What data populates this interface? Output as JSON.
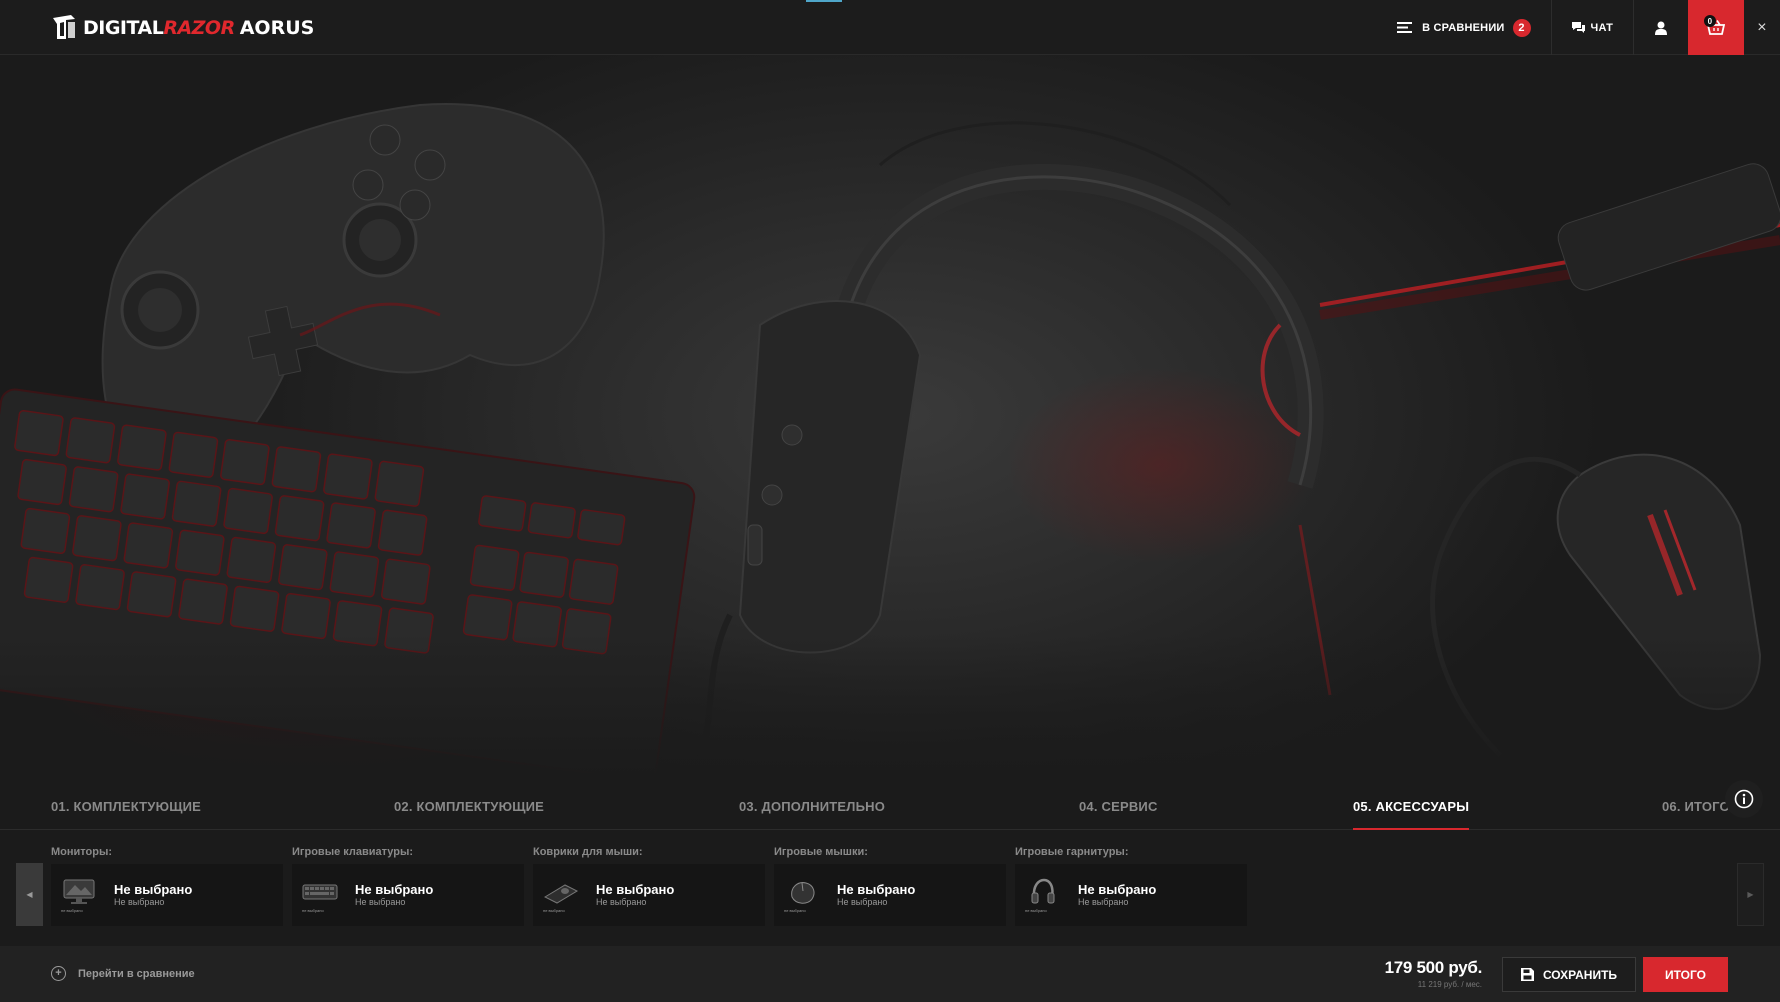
{
  "header": {
    "logo": {
      "part1": "DIGITAL",
      "part2": "RAZOR",
      "part3": "AORUS"
    },
    "compare": {
      "label": "В сравнении",
      "count": "2"
    },
    "chat": {
      "label": "Чат"
    },
    "cart": {
      "count": "0"
    },
    "close": "×"
  },
  "steps": [
    {
      "label": "01. Комплектующие"
    },
    {
      "label": "02. Комплектующие"
    },
    {
      "label": "03. Дополнительно"
    },
    {
      "label": "04. Сервис"
    },
    {
      "label": "05. Аксессуары"
    },
    {
      "label": "06. Итого"
    }
  ],
  "accessories": [
    {
      "category": "Мониторы:",
      "title": "Не выбрано",
      "subtitle": "Не выбрано",
      "thumb_caption": "не выбрано"
    },
    {
      "category": "Игровые клавиатуры:",
      "title": "Не выбрано",
      "subtitle": "Не выбрано",
      "thumb_caption": "не выбрано"
    },
    {
      "category": "Коврики для мыши:",
      "title": "Не выбрано",
      "subtitle": "Не выбрано",
      "thumb_caption": "не выбрано"
    },
    {
      "category": "Игровые мышки:",
      "title": "Не выбрано",
      "subtitle": "Не выбрано",
      "thumb_caption": "не выбрано"
    },
    {
      "category": "Игровые гарнитуры:",
      "title": "Не выбрано",
      "subtitle": "Не выбрано",
      "thumb_caption": "не выбрано"
    }
  ],
  "footer": {
    "compare_link": "Перейти в сравнение",
    "price": "179 500 руб.",
    "price_monthly": "11 219 руб. / мес.",
    "save_label": "Сохранить",
    "total_label": "Итого"
  },
  "colors": {
    "accent": "#d8282e",
    "background": "#1b1b1b",
    "card": "#151515",
    "muted_text": "#8a8a8a"
  }
}
